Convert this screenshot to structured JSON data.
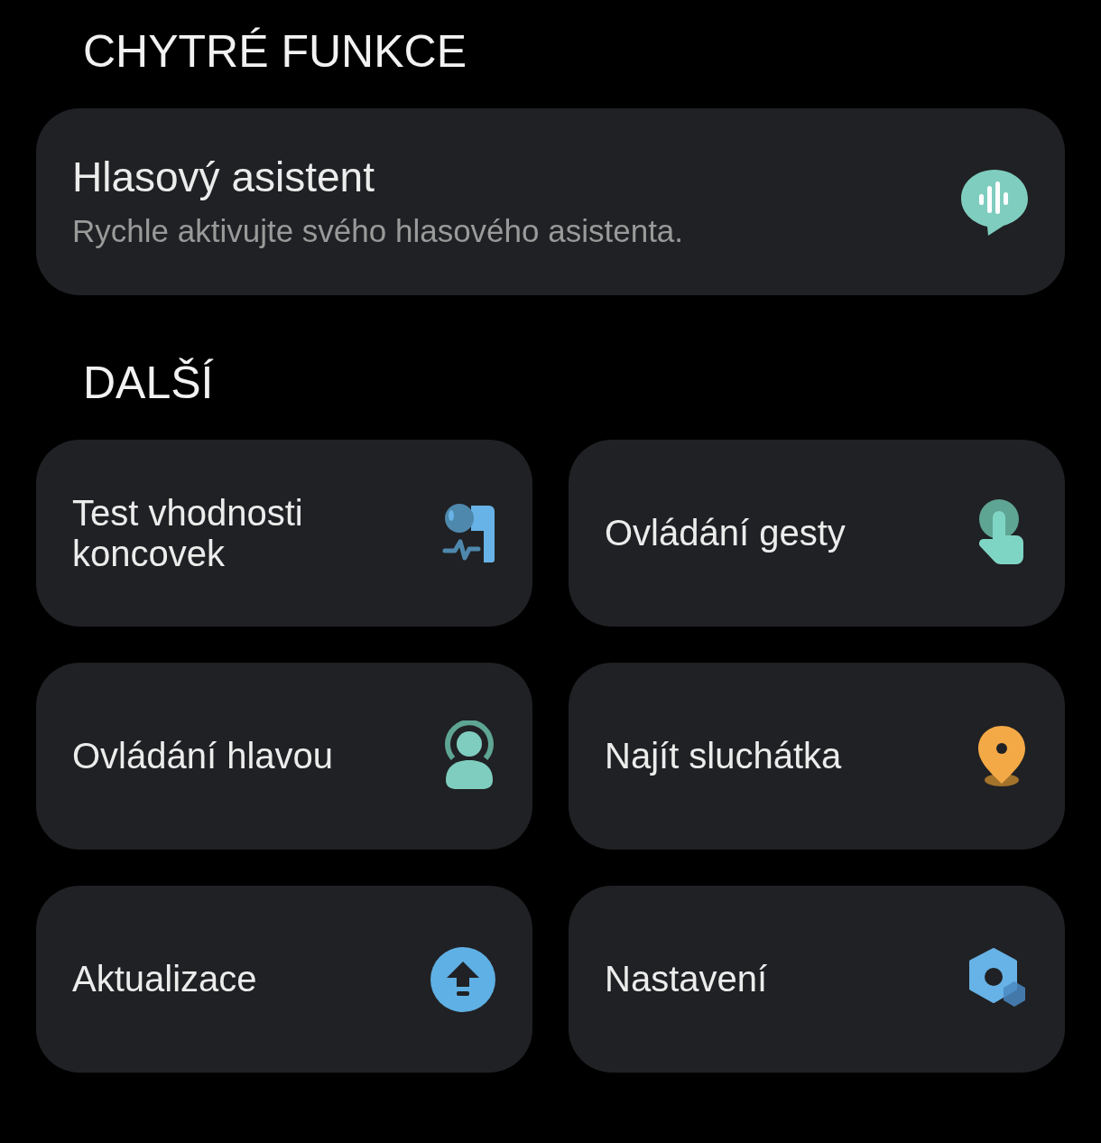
{
  "sections": [
    {
      "title": "CHYTRÉ FUNKCE",
      "items": [
        {
          "title": "Hlasový asistent",
          "subtitle": "Rychle aktivujte svého hlasového asistenta.",
          "kind": "voice"
        }
      ]
    },
    {
      "title": "DALŠÍ",
      "items": [
        {
          "title": "Test vhodnosti koncovek",
          "kind": "earbud"
        },
        {
          "title": "Ovládání gesty",
          "kind": "gesture"
        },
        {
          "title": "Ovládání hlavou",
          "kind": "head"
        },
        {
          "title": "Najít sluchátka",
          "kind": "location"
        },
        {
          "title": "Aktualizace",
          "kind": "update"
        },
        {
          "title": "Nastavení",
          "kind": "settings"
        }
      ]
    }
  ]
}
